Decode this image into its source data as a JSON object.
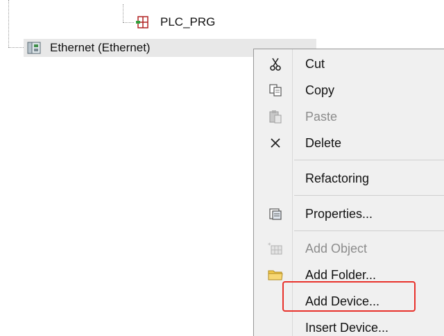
{
  "tree": {
    "plc_prg_label": "PLC_PRG",
    "ethernet_label": "Ethernet (Ethernet)"
  },
  "context_menu": {
    "items": [
      {
        "label": "Cut",
        "icon": "scissors-icon",
        "enabled": true
      },
      {
        "label": "Copy",
        "icon": "copy-icon",
        "enabled": true
      },
      {
        "label": "Paste",
        "icon": "paste-icon",
        "enabled": false
      },
      {
        "label": "Delete",
        "icon": "delete-x-icon",
        "enabled": true
      },
      {
        "label": "Refactoring",
        "icon": "",
        "enabled": true
      },
      {
        "label": "Properties...",
        "icon": "properties-icon",
        "enabled": true
      },
      {
        "label": "Add Object",
        "icon": "add-object-icon",
        "enabled": false
      },
      {
        "label": "Add Folder...",
        "icon": "folder-icon",
        "enabled": true
      },
      {
        "label": "Add Device...",
        "icon": "",
        "enabled": true,
        "highlighted": true
      },
      {
        "label": "Insert Device...",
        "icon": "",
        "enabled": true
      }
    ]
  },
  "colors": {
    "highlight_border": "#e8312b",
    "selected_row_bg": "#e8e8e8",
    "menu_bg": "#f0f0f0",
    "disabled_text": "#8c8c8c"
  }
}
